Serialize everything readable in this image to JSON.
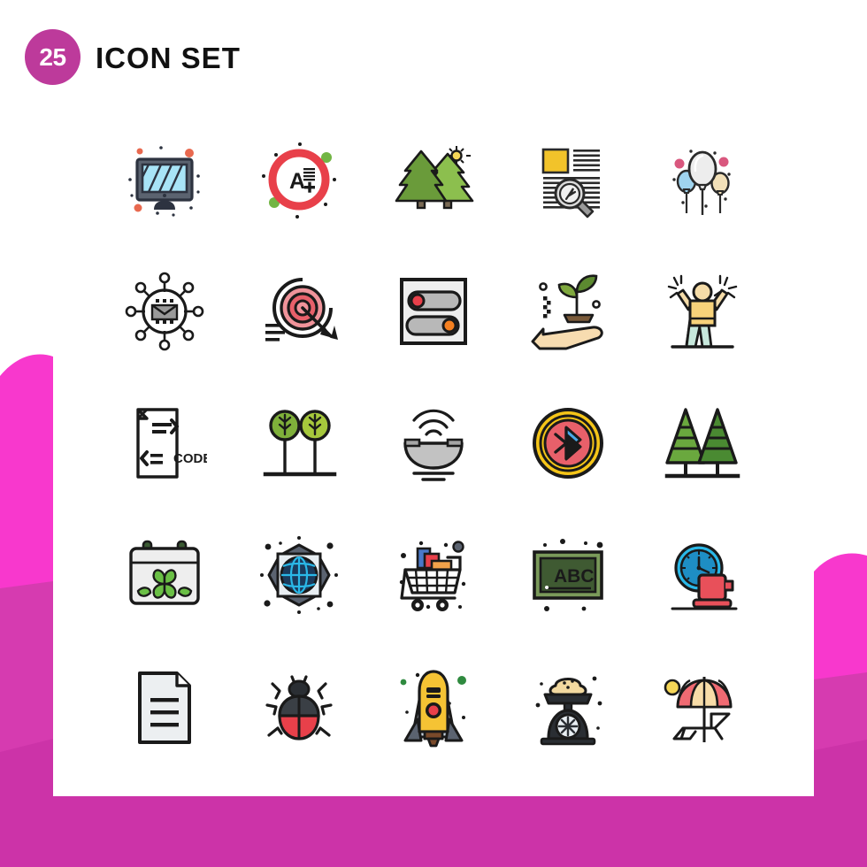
{
  "header": {
    "count": "25",
    "title": "ICON SET",
    "badge_color": "#bd3a9b",
    "title_color": "#111111"
  },
  "theme": {
    "background": "#ffffff",
    "accent_magenta_bright": "#f838cd",
    "accent_magenta_mid": "#d63bb0",
    "accent_magenta_deep": "#cc33a8",
    "stroke": "#1a1a1a"
  },
  "grid": {
    "columns": 5,
    "rows": 5,
    "total_icons": 25
  },
  "icons": [
    {
      "index": 1,
      "row": 1,
      "col": 1,
      "name": "desktop-monitor-icon",
      "label": "Desktop monitor",
      "colors": [
        "#5b6370",
        "#a8e4f7",
        "#2d3340",
        "#e8694f",
        "#7fd17f"
      ]
    },
    {
      "index": 2,
      "row": 1,
      "col": 2,
      "name": "a-plus-grade-icon",
      "label": "A plus grade",
      "colors": [
        "#e8404a",
        "#ffffff",
        "#1a1a1a",
        "#72b544"
      ]
    },
    {
      "index": 3,
      "row": 1,
      "col": 3,
      "name": "pine-forest-sun-icon",
      "label": "Pine forest with sun",
      "colors": [
        "#6a9b3a",
        "#8cbf4e",
        "#f5d657",
        "#7a6a55"
      ]
    },
    {
      "index": 4,
      "row": 1,
      "col": 4,
      "name": "document-search-icon",
      "label": "Document search",
      "colors": [
        "#f2c32a",
        "#2a2a2a",
        "#cccccc",
        "#9a9a9a"
      ]
    },
    {
      "index": 5,
      "row": 1,
      "col": 5,
      "name": "balloons-icon",
      "label": "Party balloons",
      "colors": [
        "#e8e8e8",
        "#9fd4ef",
        "#f2e0b8",
        "#d9577e"
      ]
    },
    {
      "index": 6,
      "row": 2,
      "col": 1,
      "name": "email-network-icon",
      "label": "Email network",
      "colors": [
        "#1a1a1a",
        "#9a9a9a",
        "#ffffff"
      ]
    },
    {
      "index": 7,
      "row": 2,
      "col": 2,
      "name": "target-arrow-icon",
      "label": "Target with arrow",
      "colors": [
        "#1a1a1a",
        "#e8606a",
        "#f0939a"
      ]
    },
    {
      "index": 8,
      "row": 2,
      "col": 3,
      "name": "toggle-switches-icon",
      "label": "Toggle switches",
      "colors": [
        "#eeeeee",
        "#b8b8b8",
        "#e8404a",
        "#f58020"
      ]
    },
    {
      "index": 9,
      "row": 2,
      "col": 4,
      "name": "plant-in-hand-icon",
      "label": "Plant growing in hand",
      "colors": [
        "#f7dcb0",
        "#7fa83e",
        "#5c8a30",
        "#7a5a3a"
      ]
    },
    {
      "index": 10,
      "row": 2,
      "col": 5,
      "name": "celebrating-person-icon",
      "label": "Celebrating person",
      "colors": [
        "#f7d27a",
        "#f5dca8",
        "#c7e8dc"
      ]
    },
    {
      "index": 11,
      "row": 3,
      "col": 1,
      "name": "code-file-icon",
      "label": "Code file",
      "colors": [
        "#1a1a1a",
        "#ffffff"
      ],
      "text": "CODE"
    },
    {
      "index": 12,
      "row": 3,
      "col": 2,
      "name": "two-round-trees-icon",
      "label": "Two round trees",
      "colors": [
        "#7fb03a",
        "#a6c83c",
        "#1a1a1a"
      ]
    },
    {
      "index": 13,
      "row": 3,
      "col": 3,
      "name": "wifi-dish-icon",
      "label": "Wifi satellite dish",
      "colors": [
        "#c2c2c2",
        "#1a1a1a"
      ]
    },
    {
      "index": 14,
      "row": 3,
      "col": 4,
      "name": "bluetooth-badge-icon",
      "label": "Bluetooth badge",
      "colors": [
        "#f5c518",
        "#e8606a",
        "#4aa8e8",
        "#1a1a1a"
      ]
    },
    {
      "index": 15,
      "row": 3,
      "col": 5,
      "name": "two-pine-trees-icon",
      "label": "Two pine trees",
      "colors": [
        "#4a8a32",
        "#6aa83e",
        "#1a1a1a"
      ]
    },
    {
      "index": 16,
      "row": 4,
      "col": 1,
      "name": "clover-calendar-icon",
      "label": "Clover calendar",
      "colors": [
        "#eeeeee",
        "#6abf45",
        "#3a5a32",
        "#1a1a1a"
      ]
    },
    {
      "index": 17,
      "row": 4,
      "col": 2,
      "name": "global-network-icon",
      "label": "Global network",
      "colors": [
        "#5b6370",
        "#e8eef2",
        "#1a3a5c",
        "#2ab8e8"
      ]
    },
    {
      "index": 18,
      "row": 4,
      "col": 3,
      "name": "shopping-cart-icon",
      "label": "Shopping cart",
      "colors": [
        "#1a1a1a",
        "#e8404a",
        "#4a78c8",
        "#f2a24a",
        "#5b6370"
      ]
    },
    {
      "index": 19,
      "row": 4,
      "col": 4,
      "name": "abc-blackboard-icon",
      "label": "ABC blackboard",
      "colors": [
        "#7a9a5a",
        "#3f5a32",
        "#1a1a1a"
      ],
      "text": "ABC"
    },
    {
      "index": 20,
      "row": 4,
      "col": 5,
      "name": "clock-coffee-break-icon",
      "label": "Coffee break clock",
      "colors": [
        "#2ab8e8",
        "#1e8ec4",
        "#e8505a",
        "#1a1a1a"
      ]
    },
    {
      "index": 21,
      "row": 5,
      "col": 1,
      "name": "document-file-icon",
      "label": "Document file",
      "colors": [
        "#eceff1",
        "#1a1a1a"
      ]
    },
    {
      "index": 22,
      "row": 5,
      "col": 2,
      "name": "ladybug-beetle-icon",
      "label": "Beetle bug",
      "colors": [
        "#3a3f45",
        "#2a2e33",
        "#e8404a",
        "#1a1a1a"
      ]
    },
    {
      "index": 23,
      "row": 5,
      "col": 3,
      "name": "space-shuttle-icon",
      "label": "Space shuttle",
      "colors": [
        "#f5c334",
        "#c8d4e0",
        "#5b6370",
        "#7a4a2a",
        "#e8404a",
        "#2f8a3f"
      ]
    },
    {
      "index": 24,
      "row": 5,
      "col": 4,
      "name": "kitchen-scale-icon",
      "label": "Kitchen weighing scale",
      "colors": [
        "#2a2e33",
        "#f2d9a0",
        "#e8eef2"
      ]
    },
    {
      "index": 25,
      "row": 5,
      "col": 5,
      "name": "beach-lounger-icon",
      "label": "Beach umbrella lounger",
      "colors": [
        "#f06a72",
        "#f7dca8",
        "#f5d657",
        "#1a1a1a"
      ]
    }
  ]
}
